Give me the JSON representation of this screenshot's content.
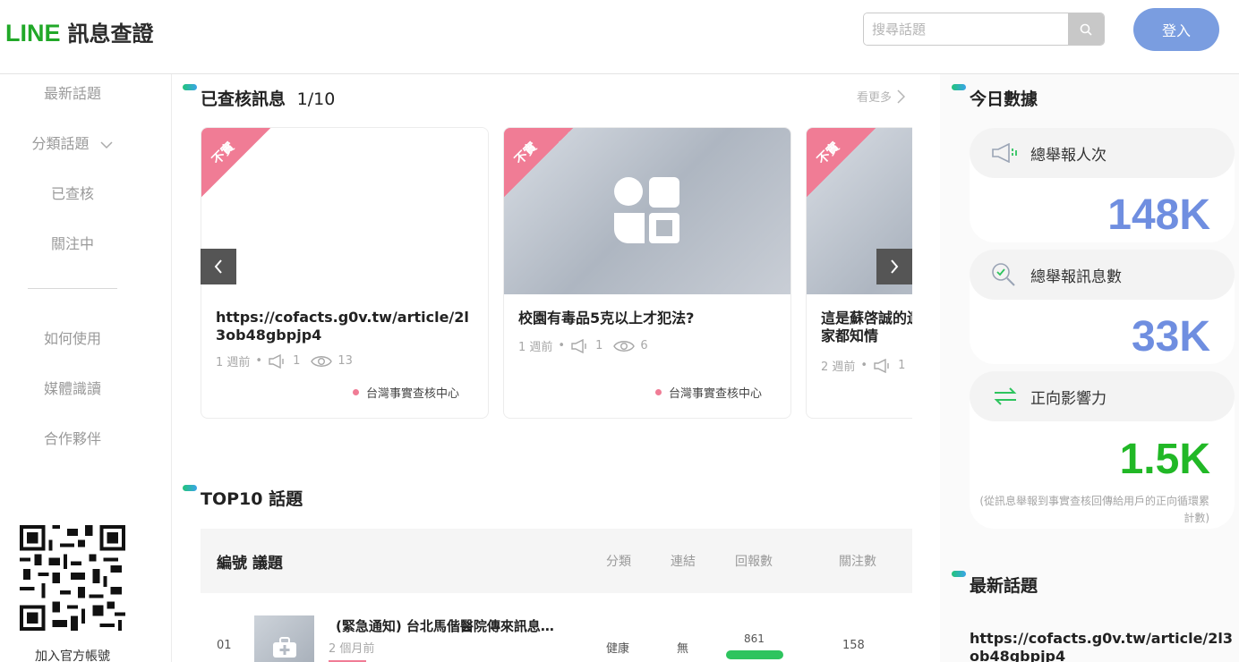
{
  "header": {
    "logo_line": "LINE",
    "logo_text": "訊息查證",
    "search_placeholder": "搜尋話題",
    "login_label": "登入"
  },
  "sidebar": {
    "items": [
      "最新話題",
      "分類話題",
      "已查核",
      "關注中",
      "如何使用",
      "媒體識讀",
      "合作夥伴"
    ],
    "qr_label": "加入官方帳號"
  },
  "checked": {
    "title": "已查核訊息",
    "counter": "1/10",
    "see_more": "看更多",
    "cards": [
      {
        "badge": "不實",
        "title": "https://cofacts.g0v.tw/article/2l3ob48gbpjp4",
        "time": "1 週前",
        "reports": "1",
        "views": "13",
        "source": "台灣事實查核中心"
      },
      {
        "badge": "不實",
        "title": "校園有毒品5克以上才犯法?",
        "time": "1 週前",
        "reports": "1",
        "views": "6",
        "source": "台灣事實查核中心"
      },
      {
        "badge": "不實",
        "title": "這是蘇啓誠的遺\n家都知情",
        "time": "2 週前",
        "reports": "1",
        "views": "",
        "source": ""
      }
    ]
  },
  "top10": {
    "title": "TOP10 話題",
    "headers": {
      "main": "編號 議題",
      "category": "分類",
      "link": "連結",
      "replies": "回報數",
      "follows": "關注數"
    },
    "rows": [
      {
        "num": "01",
        "title": "(緊急通知) 台北馬偕醫院傳來訊息…",
        "time": "2 個月前",
        "category": "健康",
        "link": "無",
        "replies": "861",
        "follows": "158"
      }
    ]
  },
  "today": {
    "title": "今日數據",
    "stats": [
      {
        "label": "總舉報人次",
        "value": "148K",
        "icon": "megaphone-icon",
        "color": "#6f8ee0"
      },
      {
        "label": "總舉報訊息數",
        "value": "33K",
        "icon": "magnify-check-icon",
        "color": "#6f8ee0"
      },
      {
        "label": "正向影響力",
        "value": "1.5K",
        "icon": "exchange-arrows-icon",
        "color": "#21b826"
      }
    ],
    "note": "(從訊息舉報到事實查核回傳給用戶的正向循環累計數)"
  },
  "latest": {
    "title": "最新話題",
    "item": "https://cofacts.g0v.tw/article/2l3ob48gbpjp4"
  }
}
